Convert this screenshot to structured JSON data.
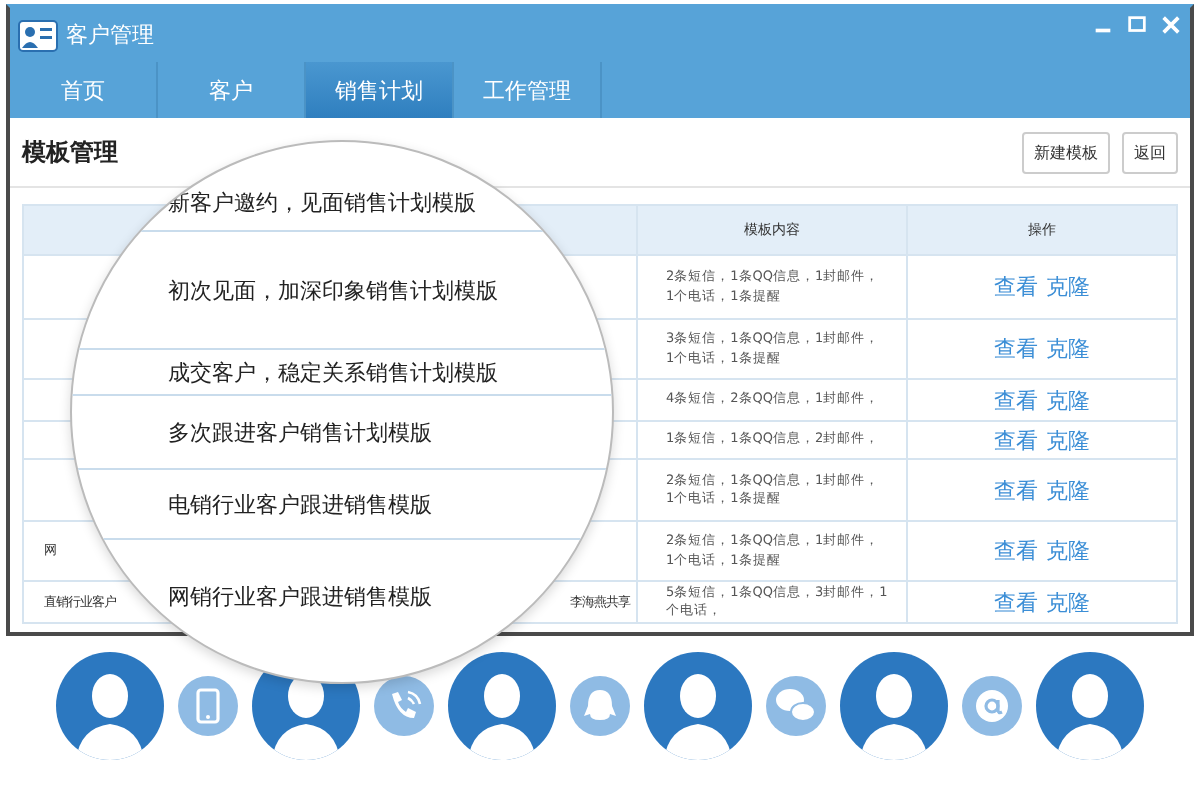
{
  "window": {
    "title": "客户管理"
  },
  "tabs": [
    {
      "label": "首页",
      "selected": false
    },
    {
      "label": "客户",
      "selected": false
    },
    {
      "label": "销售计划",
      "selected": true
    },
    {
      "label": "工作管理",
      "selected": false
    }
  ],
  "page": {
    "title": "模板管理",
    "buttons": [
      "新建模板",
      "返回"
    ]
  },
  "table": {
    "columns": [
      "模板内容",
      "操作"
    ],
    "rows": [
      {
        "name": "",
        "creator": "",
        "content": "2条短信，1条QQ信息，1封邮件，\n1个电话，1条提醒",
        "actions": [
          "查看",
          "克隆"
        ]
      },
      {
        "name": "",
        "creator": "",
        "content": "3条短信，1条QQ信息，1封邮件，\n1个电话，1条提醒",
        "actions": [
          "查看",
          "克隆"
        ]
      },
      {
        "name": "",
        "creator": "",
        "content": "4条短信，2条QQ信息，1封邮件，",
        "actions": [
          "查看",
          "克隆"
        ]
      },
      {
        "name": "",
        "creator": "",
        "content": "1条短信，1条QQ信息，2封邮件，",
        "actions": [
          "查看",
          "克隆"
        ]
      },
      {
        "name": "",
        "creator": "",
        "content": "2条短信，1条QQ信息，1封邮件，\n1个电话，1条提醒",
        "actions": [
          "查看",
          "克隆"
        ]
      },
      {
        "name": "网",
        "creator": "",
        "content": "2条短信，1条QQ信息，1封邮件，\n1个电话，1条提醒",
        "actions": [
          "查看",
          "克隆"
        ]
      },
      {
        "name": "直销行业客户",
        "creator": "李海燕共享",
        "content": "5条短信，1条QQ信息，3封邮件，1个电话，",
        "actions": [
          "查看",
          "克隆"
        ]
      }
    ]
  },
  "magnifier": {
    "items": [
      "新客户邀约，见面销售计划模版",
      "初次见面，加深印象销售计划模版",
      "成交客户，稳定关系销售计划模版",
      "多次跟进客户销售计划模版",
      "电销行业客户跟进销售模版",
      "网销行业客户跟进销售模版"
    ]
  }
}
